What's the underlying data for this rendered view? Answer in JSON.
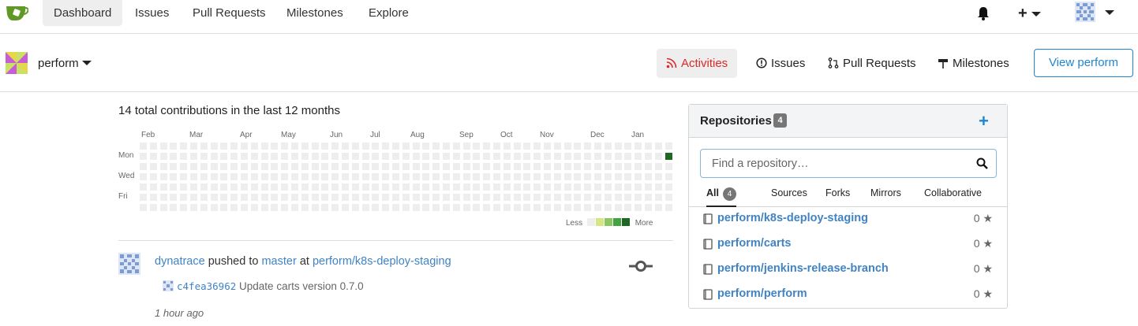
{
  "nav": {
    "items": [
      "Dashboard",
      "Issues",
      "Pull Requests",
      "Milestones",
      "Explore"
    ],
    "plus_label": "+"
  },
  "org": {
    "name": "perform",
    "tabs": [
      "Activities",
      "Issues",
      "Pull Requests",
      "Milestones"
    ],
    "view_button": "View perform"
  },
  "heatmap": {
    "title": "14 total contributions in the last 12 months",
    "months": [
      "Feb",
      "Mar",
      "Apr",
      "May",
      "Jun",
      "Jul",
      "Aug",
      "Sep",
      "Oct",
      "Nov",
      "Dec",
      "Jan"
    ],
    "days": [
      "Mon",
      "Wed",
      "Fri"
    ],
    "legend_less": "Less",
    "legend_more": "More",
    "colors": [
      "#eeeeee",
      "#d6e685",
      "#8cc665",
      "#44a340",
      "#1e6823"
    ],
    "active_cell": {
      "week_from_end": 0,
      "day": "Mon",
      "level": 4
    }
  },
  "feed": {
    "user": "dynatrace",
    "action": "pushed to",
    "branch": "master",
    "at": "at",
    "repo": "perform/k8s-deploy-staging",
    "commit_sha": "c4fea36962",
    "commit_msg": "Update carts version 0.7.0",
    "time": "1 hour ago"
  },
  "repos": {
    "title": "Repositories",
    "count": "4",
    "search_placeholder": "Find a repository…",
    "filters": [
      "All",
      "Sources",
      "Forks",
      "Mirrors",
      "Collaborative"
    ],
    "all_count": "4",
    "items": [
      {
        "name": "perform/k8s-deploy-staging",
        "stars": "0"
      },
      {
        "name": "perform/carts",
        "stars": "0"
      },
      {
        "name": "perform/jenkins-release-branch",
        "stars": "0"
      },
      {
        "name": "perform/perform",
        "stars": "0"
      }
    ]
  },
  "colors": {
    "accent": "#2185d0",
    "link": "#4183c4",
    "active_tab": "#db2828"
  }
}
